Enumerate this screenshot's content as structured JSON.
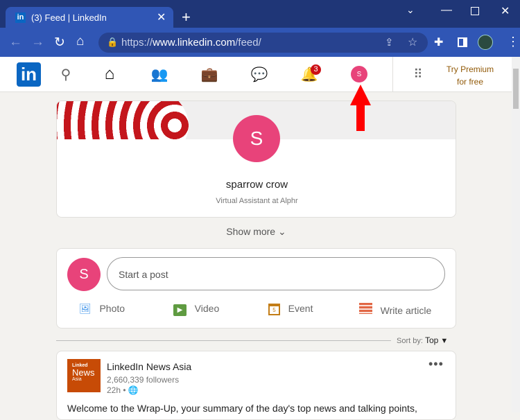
{
  "browser": {
    "tab_title": "(3) Feed | LinkedIn",
    "url_prefix": "https://",
    "url_domain": "www.linkedin.com",
    "url_path": "/feed/"
  },
  "nav": {
    "logo": "in",
    "notifications_count": "3",
    "avatar_initial": "S",
    "premium_line1": "Try Premium",
    "premium_line2": "for free"
  },
  "profile": {
    "initial": "S",
    "name": "sparrow crow",
    "headline": "Virtual Assistant at Alphr",
    "show_more": "Show more"
  },
  "composer": {
    "initial": "S",
    "placeholder": "Start a post",
    "actions": [
      {
        "label": "Photo",
        "color": "#378fe9"
      },
      {
        "label": "Video",
        "color": "#5f9b41"
      },
      {
        "label": "Event",
        "color": "#c37d16"
      },
      {
        "label": "Write article",
        "color": "#e16745"
      }
    ]
  },
  "sort": {
    "label": "Sort by:",
    "value": "Top"
  },
  "post": {
    "logo_line1": "Linked",
    "logo_line2": "News",
    "logo_line3": "Asia",
    "author": "LinkedIn News Asia",
    "followers": "2,660,339 followers",
    "time": "22h •",
    "text": "Welcome to the Wrap-Up, your summary of the day's top news and talking points,"
  }
}
